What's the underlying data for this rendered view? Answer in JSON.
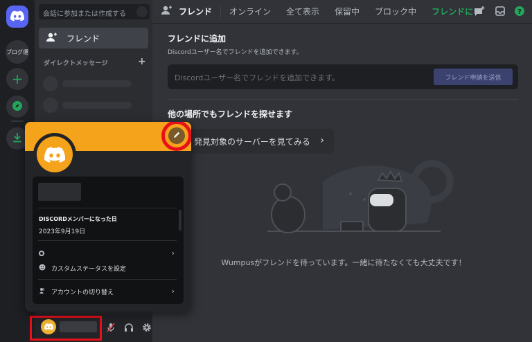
{
  "rail": {
    "server_label": "ブログ運",
    "add_symbol": "+"
  },
  "sidebar": {
    "search_placeholder": "会話に参加または作成する",
    "friends_label": "フレンド",
    "dm_header": "ダイレクトメッセージ",
    "dm_add_symbol": "+"
  },
  "topbar": {
    "title": "フレンド",
    "tabs": [
      "オンライン",
      "全て表示",
      "保留中",
      "ブロック中"
    ],
    "add_friend_tab": "フレンドに"
  },
  "main": {
    "add_heading": "フレンドに追加",
    "add_subtitle": "Discordユーザー名でフレンドを追加できます。",
    "add_input_placeholder": "Discordユーザー名でフレンドを追加できます。",
    "add_button": "フレンド申請を送信",
    "elsewhere_heading": "他の場所でもフレンドを探せます",
    "explore_button": "発見対象のサーバーを見てみる",
    "empty_text": "Wumpusがフレンドを待っています。一緒に待たなくても大丈夫です！"
  },
  "profile_popout": {
    "member_since_label": "DISCORDメンバーになった日",
    "member_since_date": "2023年9月19日",
    "custom_status_label": "カスタムステータスを設定",
    "switch_account_label": "アカウントの切り替え",
    "accent_color": "#f5a31a",
    "highlight_color": "#e8101a"
  },
  "colors": {
    "blurple": "#5865f2",
    "green": "#23a55a",
    "background": "#313338"
  }
}
